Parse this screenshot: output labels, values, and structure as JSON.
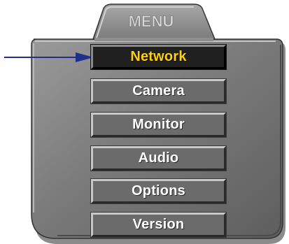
{
  "menu": {
    "title": "MENU",
    "items": [
      {
        "label": "Network",
        "selected": true
      },
      {
        "label": "Camera",
        "selected": false
      },
      {
        "label": "Monitor",
        "selected": false
      },
      {
        "label": "Audio",
        "selected": false
      },
      {
        "label": "Options",
        "selected": false
      },
      {
        "label": "Version",
        "selected": false
      }
    ]
  },
  "pointer": {
    "icon": "arrow-right-icon",
    "target": "Network"
  },
  "colors": {
    "panel": "#7a7a7a",
    "button": "#6b6b6b",
    "button_selected": "#202020",
    "selected_text": "#ffd200",
    "text": "#ffffff",
    "title_text": "#d8d8d8",
    "pointer": "#1f2f8c"
  }
}
